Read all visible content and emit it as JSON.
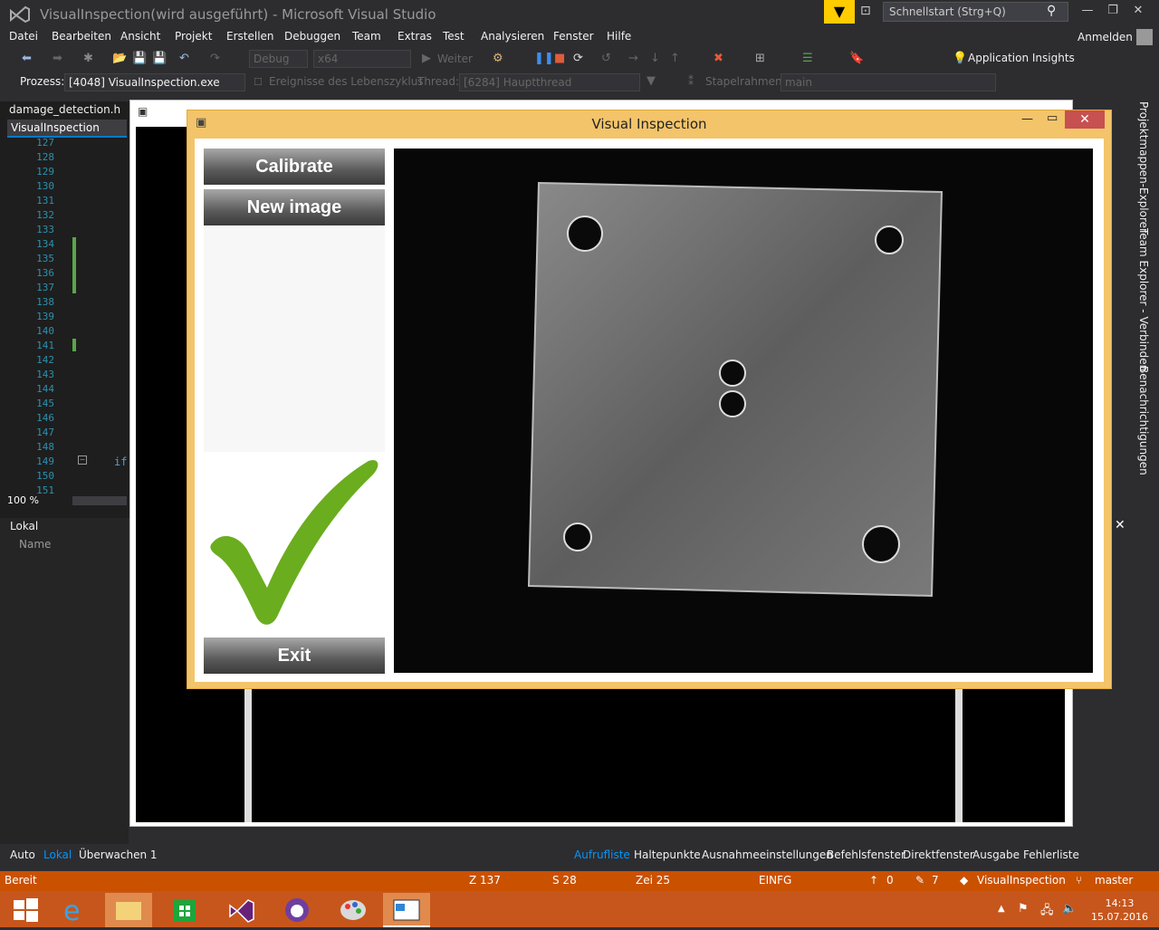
{
  "window": {
    "title": "VisualInspection(wird ausgeführt) - Microsoft Visual Studio",
    "quick_launch": "Schnellstart (Strg+Q)",
    "sign_in": "Anmelden"
  },
  "menu": [
    "Datei",
    "Bearbeiten",
    "Ansicht",
    "Projekt",
    "Erstellen",
    "Debuggen",
    "Team",
    "Extras",
    "Test",
    "Analysieren",
    "Fenster",
    "Hilfe"
  ],
  "toolbar": {
    "config": "Debug",
    "platform": "x64",
    "continue": "Weiter",
    "app_insights": "Application Insights"
  },
  "debug_bar": {
    "process_label": "Prozess:",
    "process": "[4048] VisualInspection.exe",
    "lifecycle": "Ereignisse des Lebenszyklus",
    "thread_label": "Thread:",
    "thread": "[6284] Hauptthread",
    "stack_label": "Stapelrahmen:",
    "stack": "main"
  },
  "editor": {
    "file_tab": "damage_detection.h",
    "project_tab": "VisualInspection",
    "line_numbers": [
      "127",
      "128",
      "129",
      "130",
      "131",
      "132",
      "133",
      "134",
      "135",
      "136",
      "137",
      "138",
      "139",
      "140",
      "141",
      "142",
      "143",
      "144",
      "145",
      "146",
      "147",
      "148",
      "149",
      "150",
      "151"
    ],
    "code_if": "if",
    "zoom": "100 %"
  },
  "locals": {
    "title": "Lokal",
    "col_name": "Name"
  },
  "bottom_tabs_left": [
    "Auto",
    "Lokal",
    "Überwachen 1"
  ],
  "bottom_tabs_right": [
    "Aufrufliste",
    "Haltepunkte",
    "Ausnahmeeinstellungen",
    "Befehlsfenster",
    "Direktfenster",
    "Ausgabe",
    "Fehlerliste"
  ],
  "right_dock": [
    "Projektmappen-Explorer",
    "Team Explorer - Verbinden",
    "Benachrichtigungen"
  ],
  "vi": {
    "title": "Visual Inspection",
    "calibrate": "Calibrate",
    "new_image": "New image",
    "exit": "Exit",
    "result_icon": "checkmark-icon",
    "accent": "#6aad1e"
  },
  "status": {
    "ready": "Bereit",
    "line": "Z 137",
    "col": "S 28",
    "char": "Zei 25",
    "mode": "EINFG",
    "up": "0",
    "edits": "7",
    "repo": "VisualInspection",
    "branch": "master"
  },
  "clock": {
    "time": "14:13",
    "date": "15.07.2016"
  },
  "colors": {
    "status_bar": "#ca5100",
    "taskbar": "#c7561c",
    "vi_frame": "#f3c46a"
  }
}
